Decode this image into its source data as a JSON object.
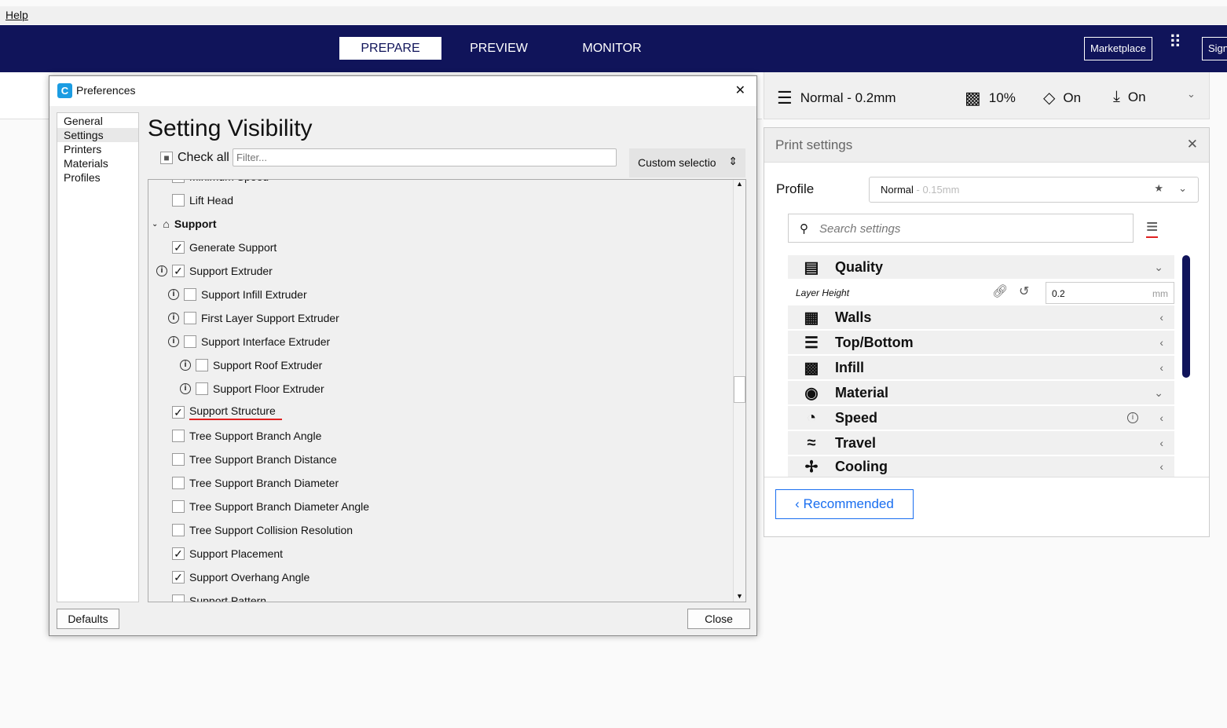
{
  "menubar": {
    "help": "Help"
  },
  "header": {
    "tabs": [
      "PREPARE",
      "PREVIEW",
      "MONITOR"
    ],
    "marketplace": "Marketplace",
    "sign_in": "Sign"
  },
  "print_bar": {
    "profile": "Normal - 0.2mm",
    "infill": "10%",
    "support": "On",
    "adhesion": "On"
  },
  "print_settings": {
    "title": "Print settings",
    "profile_label": "Profile",
    "profile_name": "Normal",
    "profile_detail": " - 0.15mm",
    "search_placeholder": "Search settings",
    "categories": [
      {
        "label": "Quality",
        "icon": "quality-icon",
        "expanded": true
      },
      {
        "label": "Walls",
        "icon": "walls-icon"
      },
      {
        "label": "Top/Bottom",
        "icon": "top-bottom-icon"
      },
      {
        "label": "Infill",
        "icon": "infill-icon"
      },
      {
        "label": "Material",
        "icon": "material-icon",
        "expanded": true
      },
      {
        "label": "Speed",
        "icon": "speed-icon"
      },
      {
        "label": "Travel",
        "icon": "travel-icon"
      },
      {
        "label": "Cooling",
        "icon": "cooling-icon"
      }
    ],
    "layer_height": {
      "label": "Layer Height",
      "value": "0.2",
      "unit": "mm"
    },
    "recommended": "Recommended"
  },
  "dialog": {
    "title": "Preferences",
    "nav": [
      "General",
      "Settings",
      "Printers",
      "Materials",
      "Profiles"
    ],
    "selected_nav": "Settings",
    "heading": "Setting Visibility",
    "check_all": "Check all",
    "filter_placeholder": "Filter...",
    "preset": "Custom selection",
    "defaults": "Defaults",
    "close": "Close",
    "items": [
      {
        "label": "Minimum Speed",
        "checked": false,
        "indent": 0
      },
      {
        "label": "Lift Head",
        "checked": false,
        "indent": 0
      },
      {
        "label": "Support",
        "section": true
      },
      {
        "label": "Generate Support",
        "checked": true,
        "indent": 0
      },
      {
        "label": "Support Extruder",
        "checked": true,
        "indent": 0,
        "info": true
      },
      {
        "label": "Support Infill Extruder",
        "checked": false,
        "indent": 1,
        "info": true
      },
      {
        "label": "First Layer Support Extruder",
        "checked": false,
        "indent": 1,
        "info": true
      },
      {
        "label": "Support Interface Extruder",
        "checked": false,
        "indent": 1,
        "info": true
      },
      {
        "label": "Support Roof Extruder",
        "checked": false,
        "indent": 2,
        "info": true
      },
      {
        "label": "Support Floor Extruder",
        "checked": false,
        "indent": 2,
        "info": true
      },
      {
        "label": "Support Structure",
        "checked": true,
        "indent": 0
      },
      {
        "label": "Tree Support Branch Angle",
        "checked": false,
        "indent": 0
      },
      {
        "label": "Tree Support Branch Distance",
        "checked": false,
        "indent": 0
      },
      {
        "label": "Tree Support Branch Diameter",
        "checked": false,
        "indent": 0
      },
      {
        "label": "Tree Support Branch Diameter Angle",
        "checked": false,
        "indent": 0
      },
      {
        "label": "Tree Support Collision Resolution",
        "checked": false,
        "indent": 0
      },
      {
        "label": "Support Placement",
        "checked": true,
        "indent": 0
      },
      {
        "label": "Support Overhang Angle",
        "checked": true,
        "indent": 0
      },
      {
        "label": "Support Pattern",
        "checked": false,
        "indent": 0
      }
    ]
  },
  "colors": {
    "header": "#10145a",
    "accent": "#196ef0",
    "annotation": "#e02020"
  }
}
